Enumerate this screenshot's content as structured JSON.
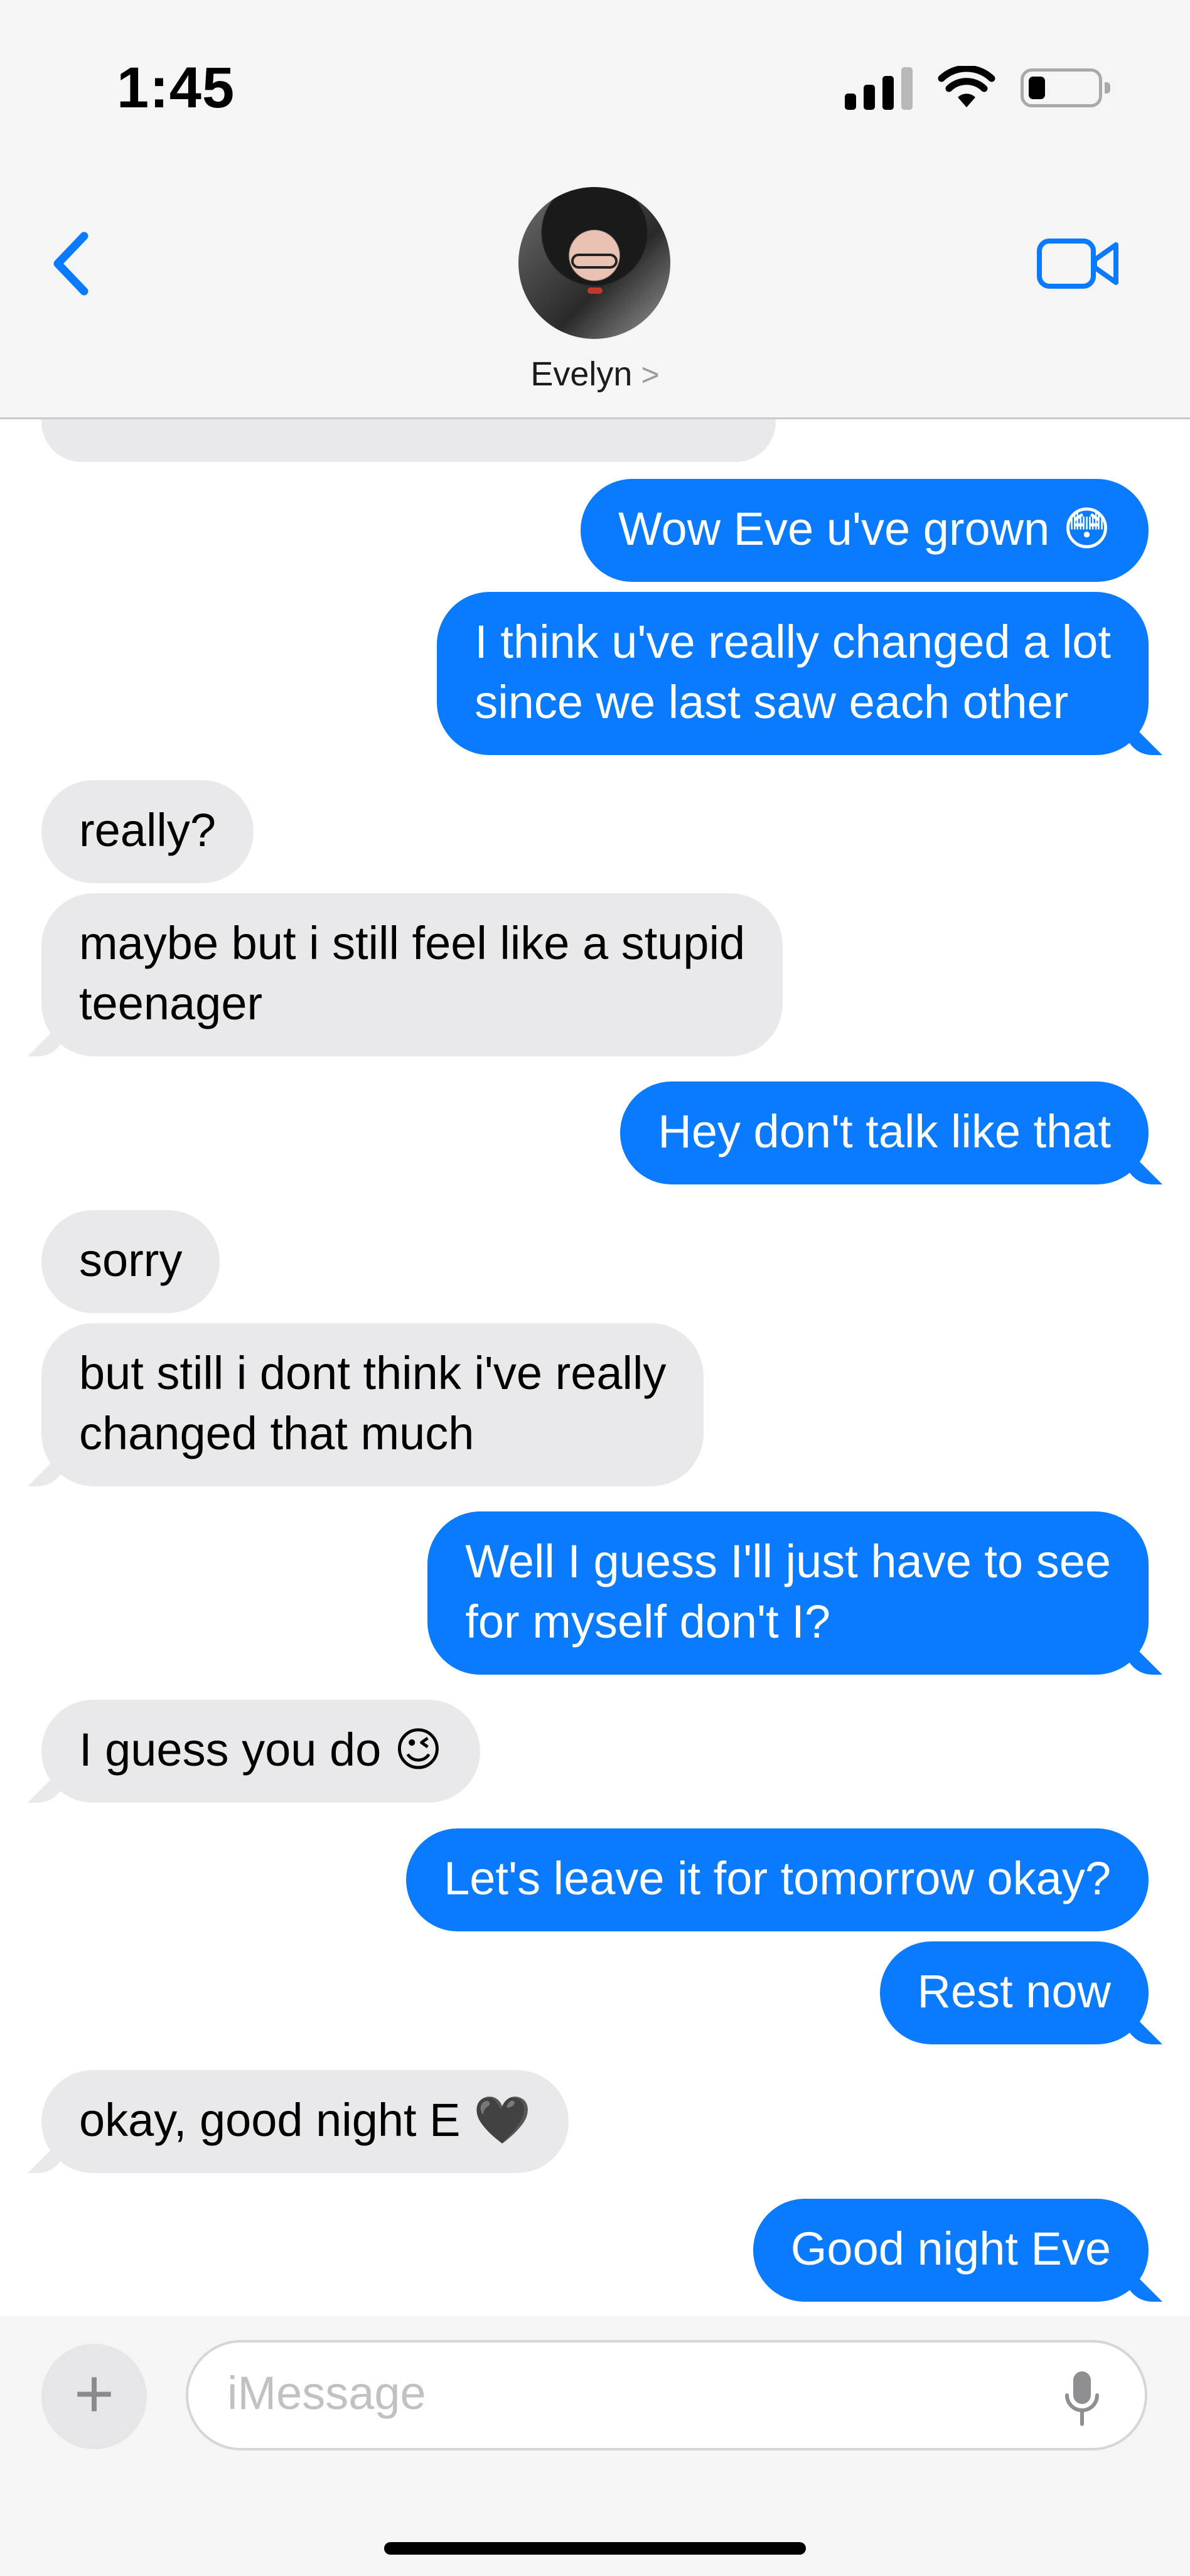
{
  "status_bar": {
    "time": "1:45"
  },
  "header": {
    "contact_name": "Evelyn",
    "chevron": ">"
  },
  "messages": [
    {
      "dir": "in",
      "text": ""
    },
    {
      "dir": "out",
      "text": "Wow Eve u've grown 😳"
    },
    {
      "dir": "out",
      "lines": [
        "I think u've really changed a lot",
        "since we last saw each other"
      ]
    },
    {
      "dir": "in",
      "text": "really?"
    },
    {
      "dir": "in",
      "lines": [
        "maybe but i still feel like a stupid",
        "teenager"
      ]
    },
    {
      "dir": "out",
      "text": "Hey don't talk like that"
    },
    {
      "dir": "in",
      "text": "sorry"
    },
    {
      "dir": "in",
      "lines": [
        "but still i dont think i've really",
        "changed that much"
      ]
    },
    {
      "dir": "out",
      "lines": [
        "Well I guess I'll just have to see",
        "for myself don't I?"
      ]
    },
    {
      "dir": "in",
      "text": "I guess you do 😉"
    },
    {
      "dir": "out",
      "text": "Let's leave it for tomorrow okay?"
    },
    {
      "dir": "out",
      "text": "Rest now"
    },
    {
      "dir": "in",
      "text": "okay, good night E 🖤"
    },
    {
      "dir": "out",
      "text": "Good night Eve"
    }
  ],
  "composer": {
    "placeholder": "iMessage",
    "plus_label": "+"
  },
  "colors": {
    "outgoing": "#0a7aff",
    "incoming": "#e9e9eb",
    "accent": "#0a7aff"
  }
}
